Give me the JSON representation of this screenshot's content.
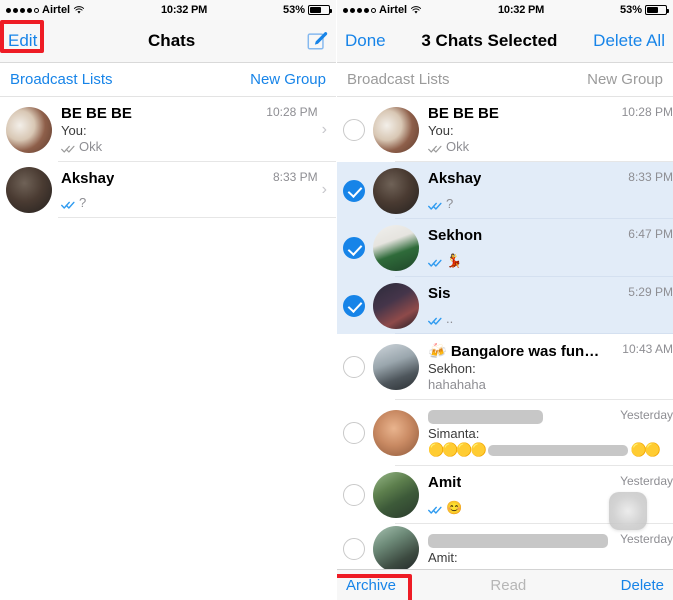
{
  "status_bar": {
    "signal_dots_filled": 4,
    "signal_dots_total": 5,
    "carrier": "Airtel",
    "time": "10:32 PM",
    "battery_percent": "53%"
  },
  "colors": {
    "accent_blue": "#1784e8",
    "selected_row_bg": "#e2ecf8",
    "annotation_red": "#ee1c25",
    "muted_gray": "#8e8e93",
    "navbar_bg": "#f7f7f7"
  },
  "left_panel": {
    "nav": {
      "left_label": "Edit",
      "title": "Chats",
      "right_icon": "compose-icon"
    },
    "broadcast_bar": {
      "left_label": "Broadcast Lists",
      "right_label": "New Group"
    },
    "chats": [
      {
        "name": "BE BE BE",
        "time": "10:28 PM",
        "sub": "You:",
        "message": "Okk",
        "ticks": "double-check-gray",
        "avatar": "m1",
        "chevron": "›"
      },
      {
        "name": "Akshay",
        "time": "8:33 PM",
        "sub": "",
        "message": "?",
        "ticks": "double-check-blue",
        "avatar": "m2",
        "chevron": "›"
      }
    ]
  },
  "right_panel": {
    "nav": {
      "left_label": "Done",
      "title": "3 Chats Selected",
      "right_label": "Delete All"
    },
    "broadcast_bar": {
      "left_label": "Broadcast Lists",
      "right_label": "New Group"
    },
    "chats": [
      {
        "name": "BE BE BE",
        "time": "10:28 PM",
        "sub": "You:",
        "message": "Okk",
        "ticks": "double-check-gray",
        "selected": false,
        "avatar": "m1",
        "redacted": false
      },
      {
        "name": "Akshay",
        "time": "8:33 PM",
        "sub": "",
        "message": "?",
        "ticks": "double-check-blue",
        "selected": true,
        "avatar": "m2",
        "redacted": false
      },
      {
        "name": "Sekhon",
        "time": "6:47 PM",
        "sub": "",
        "message": "💃",
        "ticks": "double-check-blue",
        "selected": true,
        "avatar": "m3",
        "redacted": false
      },
      {
        "name": "Sis",
        "time": "5:29 PM",
        "sub": "",
        "message": "..",
        "ticks": "double-check-blue",
        "selected": true,
        "avatar": "m4",
        "redacted": false
      },
      {
        "name": "🍻 Bangalore was fun🍋 ...",
        "time": "10:43 AM",
        "sub": "Sekhon:",
        "message": "hahahaha",
        "ticks": "none",
        "selected": false,
        "avatar": "m5",
        "redacted": false
      },
      {
        "name": "",
        "time": "Yesterday",
        "sub": "Simanta:",
        "message": "",
        "ticks": "none",
        "selected": false,
        "avatar": "m6",
        "redacted": true
      },
      {
        "name": "Amit",
        "time": "Yesterday",
        "sub": "",
        "message": "😊",
        "ticks": "double-check-blue",
        "selected": false,
        "avatar": "m7",
        "redacted": false
      },
      {
        "name": "",
        "time": "Yesterday",
        "sub": "Amit:",
        "message": "",
        "ticks": "none",
        "selected": false,
        "avatar": "m8",
        "redacted": true
      }
    ],
    "toolbar": {
      "archive_label": "Archive",
      "read_label": "Read",
      "delete_label": "Delete"
    }
  },
  "annotations": {
    "highlight_edit": "Edit",
    "highlight_archive": "Archive",
    "touch_indicator": "tap-point"
  }
}
